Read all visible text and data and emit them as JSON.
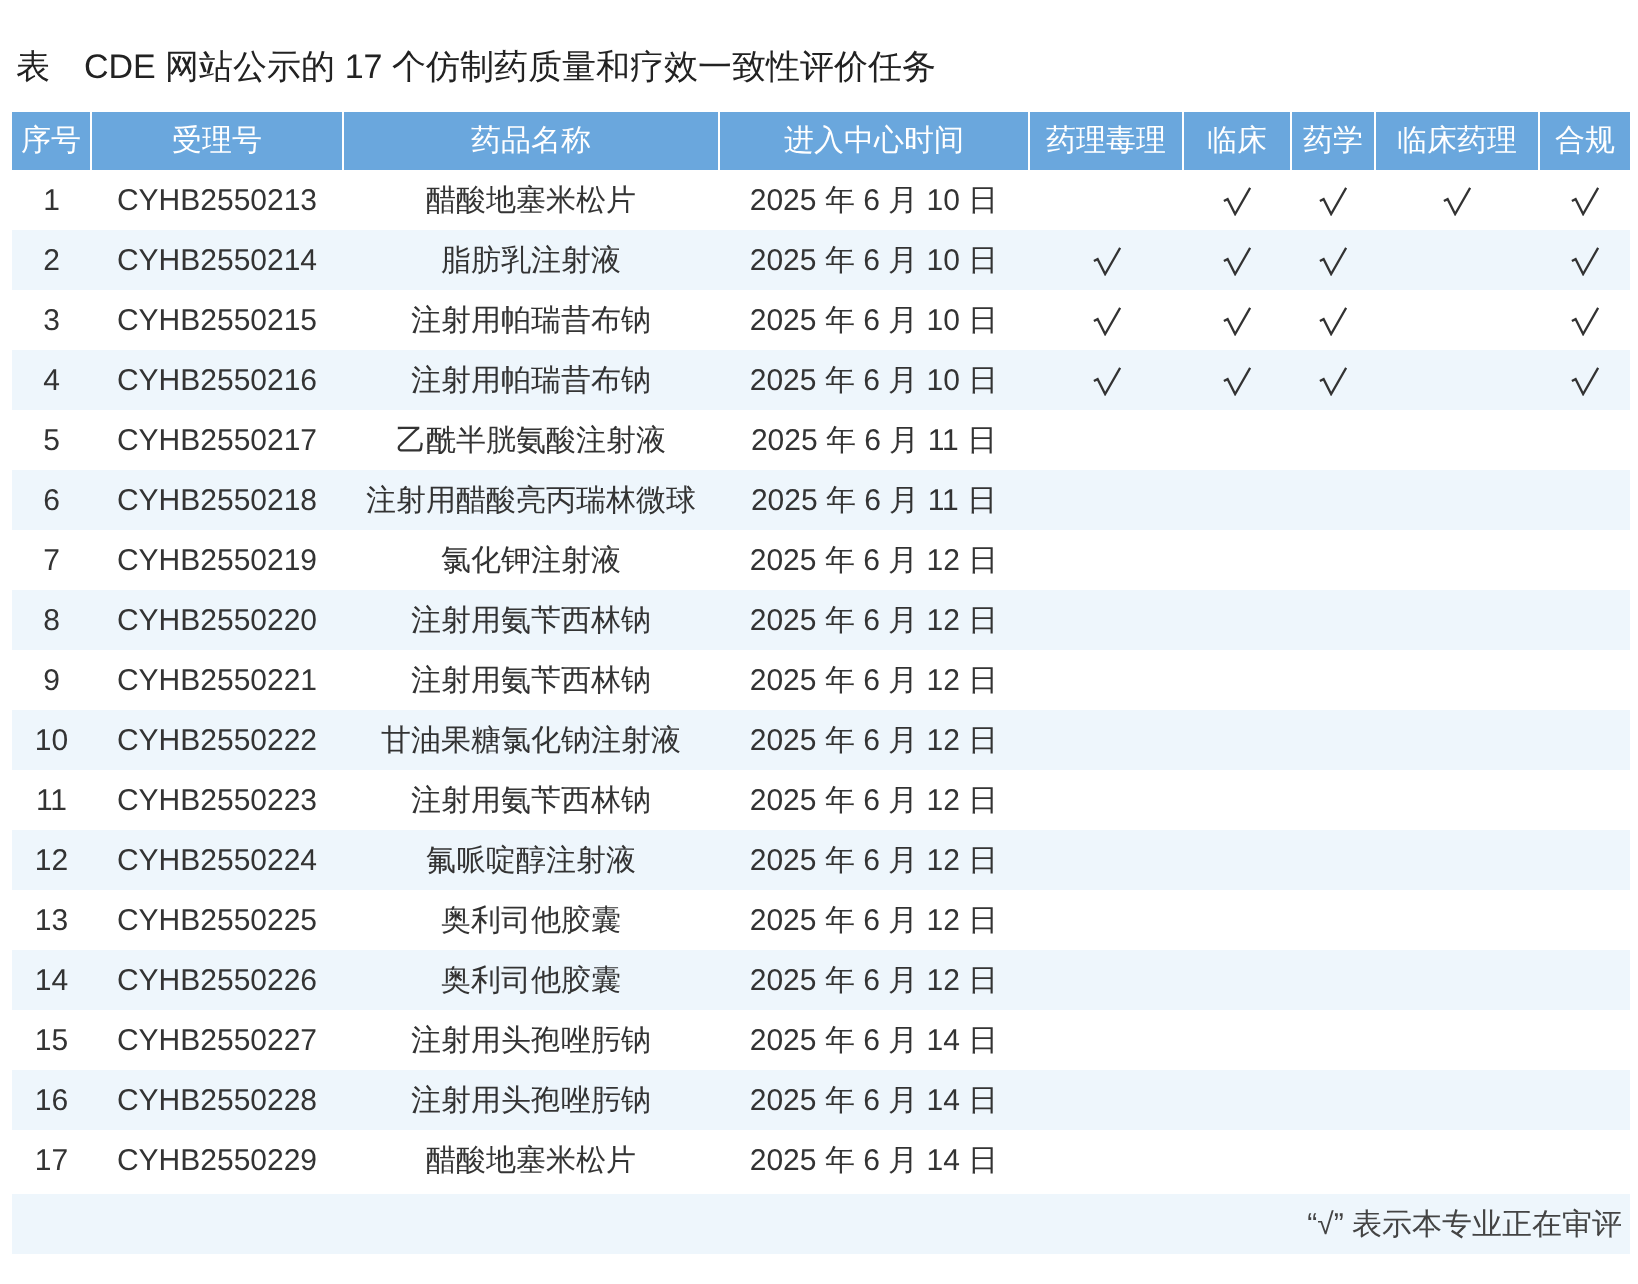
{
  "title": "表　CDE 网站公示的 17 个仿制药质量和疗效一致性评价任务",
  "table": {
    "columns": [
      "序号",
      "受理号",
      "药品名称",
      "进入中心时间",
      "药理毒理",
      "临床",
      "药学",
      "临床药理",
      "合规"
    ],
    "rows": [
      {
        "no": "1",
        "id": "CYHB2550213",
        "name": "醋酸地塞米松片",
        "date": "2025 年 6 月 10 日",
        "review": [
          false,
          true,
          true,
          true,
          true
        ]
      },
      {
        "no": "2",
        "id": "CYHB2550214",
        "name": "脂肪乳注射液",
        "date": "2025 年 6 月 10 日",
        "review": [
          true,
          true,
          true,
          false,
          true
        ]
      },
      {
        "no": "3",
        "id": "CYHB2550215",
        "name": "注射用帕瑞昔布钠",
        "date": "2025 年 6 月 10 日",
        "review": [
          true,
          true,
          true,
          false,
          true
        ]
      },
      {
        "no": "4",
        "id": "CYHB2550216",
        "name": "注射用帕瑞昔布钠",
        "date": "2025 年 6 月 10 日",
        "review": [
          true,
          true,
          true,
          false,
          true
        ]
      },
      {
        "no": "5",
        "id": "CYHB2550217",
        "name": "乙酰半胱氨酸注射液",
        "date": "2025 年 6 月 11 日",
        "review": [
          false,
          false,
          false,
          false,
          false
        ]
      },
      {
        "no": "6",
        "id": "CYHB2550218",
        "name": "注射用醋酸亮丙瑞林微球",
        "date": "2025 年 6 月 11 日",
        "review": [
          false,
          false,
          false,
          false,
          false
        ]
      },
      {
        "no": "7",
        "id": "CYHB2550219",
        "name": "氯化钾注射液",
        "date": "2025 年 6 月 12 日",
        "review": [
          false,
          false,
          false,
          false,
          false
        ]
      },
      {
        "no": "8",
        "id": "CYHB2550220",
        "name": "注射用氨苄西林钠",
        "date": "2025 年 6 月 12 日",
        "review": [
          false,
          false,
          false,
          false,
          false
        ]
      },
      {
        "no": "9",
        "id": "CYHB2550221",
        "name": "注射用氨苄西林钠",
        "date": "2025 年 6 月 12 日",
        "review": [
          false,
          false,
          false,
          false,
          false
        ]
      },
      {
        "no": "10",
        "id": "CYHB2550222",
        "name": "甘油果糖氯化钠注射液",
        "date": "2025 年 6 月 12 日",
        "review": [
          false,
          false,
          false,
          false,
          false
        ]
      },
      {
        "no": "11",
        "id": "CYHB2550223",
        "name": "注射用氨苄西林钠",
        "date": "2025 年 6 月 12 日",
        "review": [
          false,
          false,
          false,
          false,
          false
        ]
      },
      {
        "no": "12",
        "id": "CYHB2550224",
        "name": "氟哌啶醇注射液",
        "date": "2025 年 6 月 12 日",
        "review": [
          false,
          false,
          false,
          false,
          false
        ]
      },
      {
        "no": "13",
        "id": "CYHB2550225",
        "name": "奥利司他胶囊",
        "date": "2025 年 6 月 12 日",
        "review": [
          false,
          false,
          false,
          false,
          false
        ]
      },
      {
        "no": "14",
        "id": "CYHB2550226",
        "name": "奥利司他胶囊",
        "date": "2025 年 6 月 12 日",
        "review": [
          false,
          false,
          false,
          false,
          false
        ]
      },
      {
        "no": "15",
        "id": "CYHB2550227",
        "name": "注射用头孢唑肟钠",
        "date": "2025 年 6 月 14 日",
        "review": [
          false,
          false,
          false,
          false,
          false
        ]
      },
      {
        "no": "16",
        "id": "CYHB2550228",
        "name": "注射用头孢唑肟钠",
        "date": "2025 年 6 月 14 日",
        "review": [
          false,
          false,
          false,
          false,
          false
        ]
      },
      {
        "no": "17",
        "id": "CYHB2550229",
        "name": "醋酸地塞米松片",
        "date": "2025 年 6 月 14 日",
        "review": [
          false,
          false,
          false,
          false,
          false
        ]
      }
    ],
    "note": "“√” 表示本专业正在审评"
  }
}
